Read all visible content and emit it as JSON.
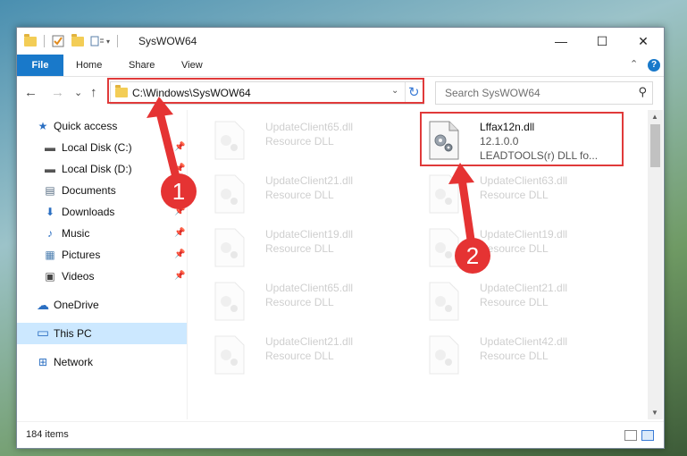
{
  "window": {
    "title": "SysWOW64",
    "controls": {
      "minimize": "—",
      "maximize": "☐",
      "close": "✕"
    }
  },
  "ribbon": {
    "tabs": [
      "File",
      "Home",
      "Share",
      "View"
    ],
    "expand_chevron": "⌃",
    "help": "?"
  },
  "nav": {
    "back": "←",
    "forward": "→",
    "recent": "⌄",
    "up": "↑",
    "address": "C:\\Windows\\SysWOW64",
    "address_dropdown": "⌄",
    "refresh": "↻",
    "search_placeholder": "Search SysWOW64",
    "search_glyph": "⚲"
  },
  "sidebar": {
    "items": [
      {
        "label": "Quick access",
        "icon": "star-icon",
        "glyph": "★",
        "pinned": false
      },
      {
        "label": "Local Disk (C:)",
        "icon": "drive-icon",
        "glyph": "▬",
        "pinned": true
      },
      {
        "label": "Local Disk (D:)",
        "icon": "drive-icon",
        "glyph": "▬",
        "pinned": true
      },
      {
        "label": "Documents",
        "icon": "documents-icon",
        "glyph": "▤",
        "pinned": true
      },
      {
        "label": "Downloads",
        "icon": "download-icon",
        "glyph": "⬇",
        "pinned": true
      },
      {
        "label": "Music",
        "icon": "music-icon",
        "glyph": "♪",
        "pinned": true
      },
      {
        "label": "Pictures",
        "icon": "pictures-icon",
        "glyph": "▦",
        "pinned": true
      },
      {
        "label": "Videos",
        "icon": "videos-icon",
        "glyph": "▣",
        "pinned": true
      },
      {
        "label": "OneDrive",
        "icon": "cloud-icon",
        "glyph": "☁",
        "pinned": false
      },
      {
        "label": "This PC",
        "icon": "computer-icon",
        "glyph": "▭",
        "pinned": false,
        "selected": true
      },
      {
        "label": "Network",
        "icon": "network-icon",
        "glyph": "⊞",
        "pinned": false
      }
    ],
    "pin_glyph": "📌"
  },
  "files": {
    "left_column": [
      {
        "name": "UpdateClient65.dll",
        "type": "Resource DLL"
      },
      {
        "name": "UpdateClient21.dll",
        "type": "Resource DLL"
      },
      {
        "name": "UpdateClient19.dll",
        "type": "Resource DLL"
      },
      {
        "name": "UpdateClient65.dll",
        "type": "Resource DLL"
      },
      {
        "name": "UpdateClient21.dll",
        "type": "Resource DLL"
      }
    ],
    "right_column": [
      {
        "name": "Lffax12n.dll",
        "version": "12.1.0.0",
        "description": "LEADTOOLS(r) DLL fo..."
      },
      {
        "name": "UpdateClient63.dll",
        "type": "Resource DLL"
      },
      {
        "name": "UpdateClient19.dll",
        "type": "Resource DLL"
      },
      {
        "name": "UpdateClient21.dll",
        "type": "Resource DLL"
      },
      {
        "name": "UpdateClient42.dll",
        "type": "Resource DLL"
      }
    ]
  },
  "status": {
    "count": "184 items"
  },
  "annotations": {
    "badge1": "1",
    "badge2": "2",
    "color": "#e53333"
  }
}
